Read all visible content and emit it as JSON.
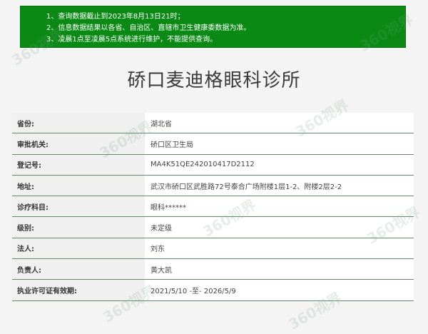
{
  "notice": {
    "lines": [
      "1、查询数据截止到2023年8月13日21时；",
      "2、信息数据结果以各省、自治区、直辖市卫生健康委数据为准。",
      "3、凌晨1点至凌晨5点系统进行维护，不能提供查询。"
    ]
  },
  "title": "硚口麦迪格眼科诊所",
  "rows": [
    {
      "label": "省份:",
      "value": "湖北省"
    },
    {
      "label": "审批机关:",
      "value": "硚口区卫生局"
    },
    {
      "label": "登记号:",
      "value": "MA4K51QE242010417D2112"
    },
    {
      "label": "地址:",
      "value": "武汉市硚口区武胜路72号泰合广场附楼1层1-2、附楼2层2-2"
    },
    {
      "label": "诊疗科目:",
      "value": "眼科******"
    },
    {
      "label": "级别:",
      "value": "未定级"
    },
    {
      "label": "法人:",
      "value": "刘东"
    },
    {
      "label": "负责人:",
      "value": "黄大凯"
    },
    {
      "label": "执业许可证有效期:",
      "value": "2021/5/10 -至- 2026/5/9"
    }
  ],
  "watermark": "360视界"
}
